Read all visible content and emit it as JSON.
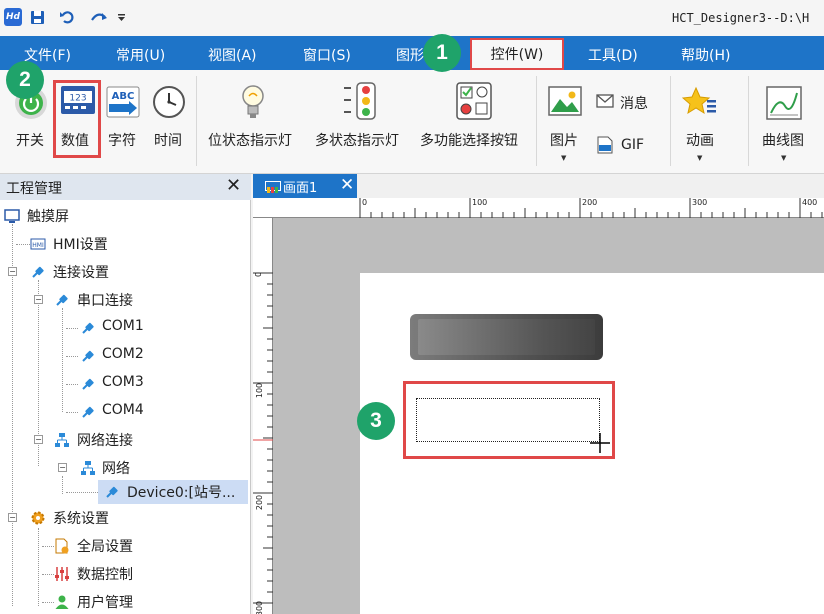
{
  "window": {
    "title": "HCT_Designer3--D:\\H"
  },
  "menu": [
    {
      "label": "文件(F)"
    },
    {
      "label": "常用(U)"
    },
    {
      "label": "视图(A)"
    },
    {
      "label": "窗口(S)"
    },
    {
      "label": "图形"
    },
    {
      "label": "控件(W)",
      "active": true
    },
    {
      "label": "工具(D)"
    },
    {
      "label": "帮助(H)"
    }
  ],
  "ribbon": {
    "switch_label": "开关",
    "numeric_label": "数值",
    "text_label": "字符",
    "time_label": "时间",
    "bit_lamp_label": "位状态指示灯",
    "multi_lamp_label": "多状态指示灯",
    "multi_select_label": "多功能选择按钮",
    "picture_label": "图片",
    "message_label": "消息",
    "gif_label": "GIF",
    "animation_label": "动画",
    "curve_label": "曲线图",
    "numeric_icon_text": "123",
    "text_icon_text": "ABC"
  },
  "project_panel": {
    "title": "工程管理",
    "close_glyph": "✕",
    "tree": [
      {
        "label": "触摸屏",
        "level": 0
      },
      {
        "label": "HMI设置",
        "level": 1
      },
      {
        "label": "连接设置",
        "level": 1
      },
      {
        "label": "串口连接",
        "level": 2
      },
      {
        "label": "COM1",
        "level": 3
      },
      {
        "label": "COM2",
        "level": 3
      },
      {
        "label": "COM3",
        "level": 3
      },
      {
        "label": "COM4",
        "level": 3
      },
      {
        "label": "网络连接",
        "level": 2
      },
      {
        "label": "网络",
        "level": 3
      },
      {
        "label": "Device0:[站号...",
        "level": 4,
        "selected": true
      },
      {
        "label": "系统设置",
        "level": 1
      },
      {
        "label": "全局设置",
        "level": 2
      },
      {
        "label": "数据控制",
        "level": 2
      },
      {
        "label": "用户管理",
        "level": 2
      }
    ]
  },
  "editor": {
    "tab_label": "画面1",
    "tab_close": "✕",
    "ruler_top": [
      "0",
      "100",
      "200",
      "300",
      "400"
    ],
    "ruler_left": [
      "0",
      "100",
      "200",
      "300"
    ]
  },
  "callouts": {
    "one": "1",
    "two": "2",
    "three": "3"
  },
  "colors": {
    "accent": "#1e74c8",
    "highlight": "#e04848",
    "badge": "#1fa36a",
    "selection": "#ccdcf4"
  }
}
